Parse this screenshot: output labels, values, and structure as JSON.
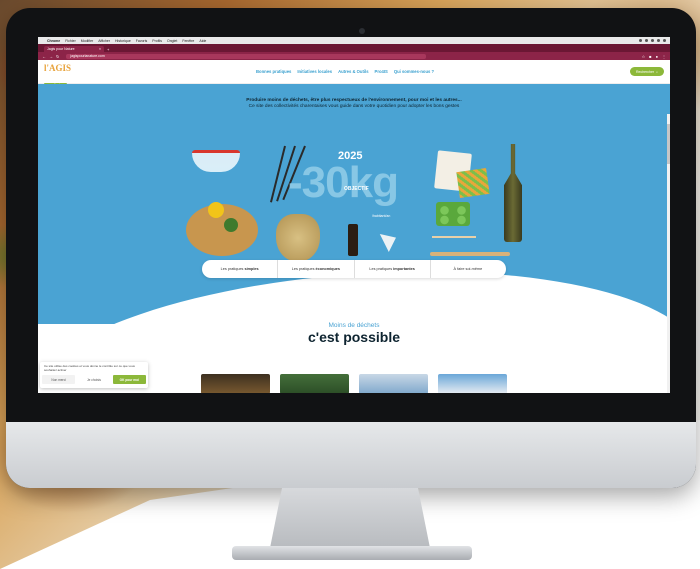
{
  "mac_menubar": {
    "app": "Chrome",
    "items": [
      "Fichier",
      "Modifier",
      "Afficher",
      "Historique",
      "Favoris",
      "Profils",
      "Onglet",
      "Fenêtre",
      "Aide"
    ]
  },
  "browser": {
    "tab_title": "Jagis pour Nature",
    "url": "jagispourlanature.com"
  },
  "site": {
    "logo_top": "l'AGIS",
    "logo_bottom": "pour l'nature",
    "nav": [
      "Bonnes pratiques",
      "Initiatives locales",
      "Autres & Outils",
      "Pro4IS",
      "Qui sommes-nous ?"
    ],
    "search_label": "Rechercher"
  },
  "hero": {
    "headline_1": "Produire moins de déchets, être plus respectueux de l'environnement, pour moi et les autres...",
    "headline_2": "Ce site des collectivités charentaises vous guide dans votre quotidien pour adopter les bons gestes",
    "year": "2025",
    "bignum": "-30kg",
    "objectif": "OBJECTIF",
    "per_habitant": "/habitant/an"
  },
  "pill_nav": [
    {
      "prefix": "Les pratiques",
      "bold": "simples"
    },
    {
      "prefix": "Les pratiques",
      "bold": "économiques"
    },
    {
      "prefix": "Les pratiques",
      "bold": "importantes"
    },
    {
      "prefix": "À faire soi-même",
      "bold": ""
    }
  ],
  "section": {
    "subtitle": "Moins de déchets",
    "title": "c'est possible"
  },
  "cookie": {
    "text": "Ce site utilise des cookies et vous donne le contrôle sur ce que vous souhaitez activer",
    "no": "Non merci",
    "choose": "Je choisis",
    "ok": "OK pour moi"
  },
  "colors": {
    "hero_blue": "#4aa3d3",
    "brand_green": "#8cb83a",
    "browser_burgundy": "#8c2448",
    "logo_orange": "#e8a33c"
  }
}
